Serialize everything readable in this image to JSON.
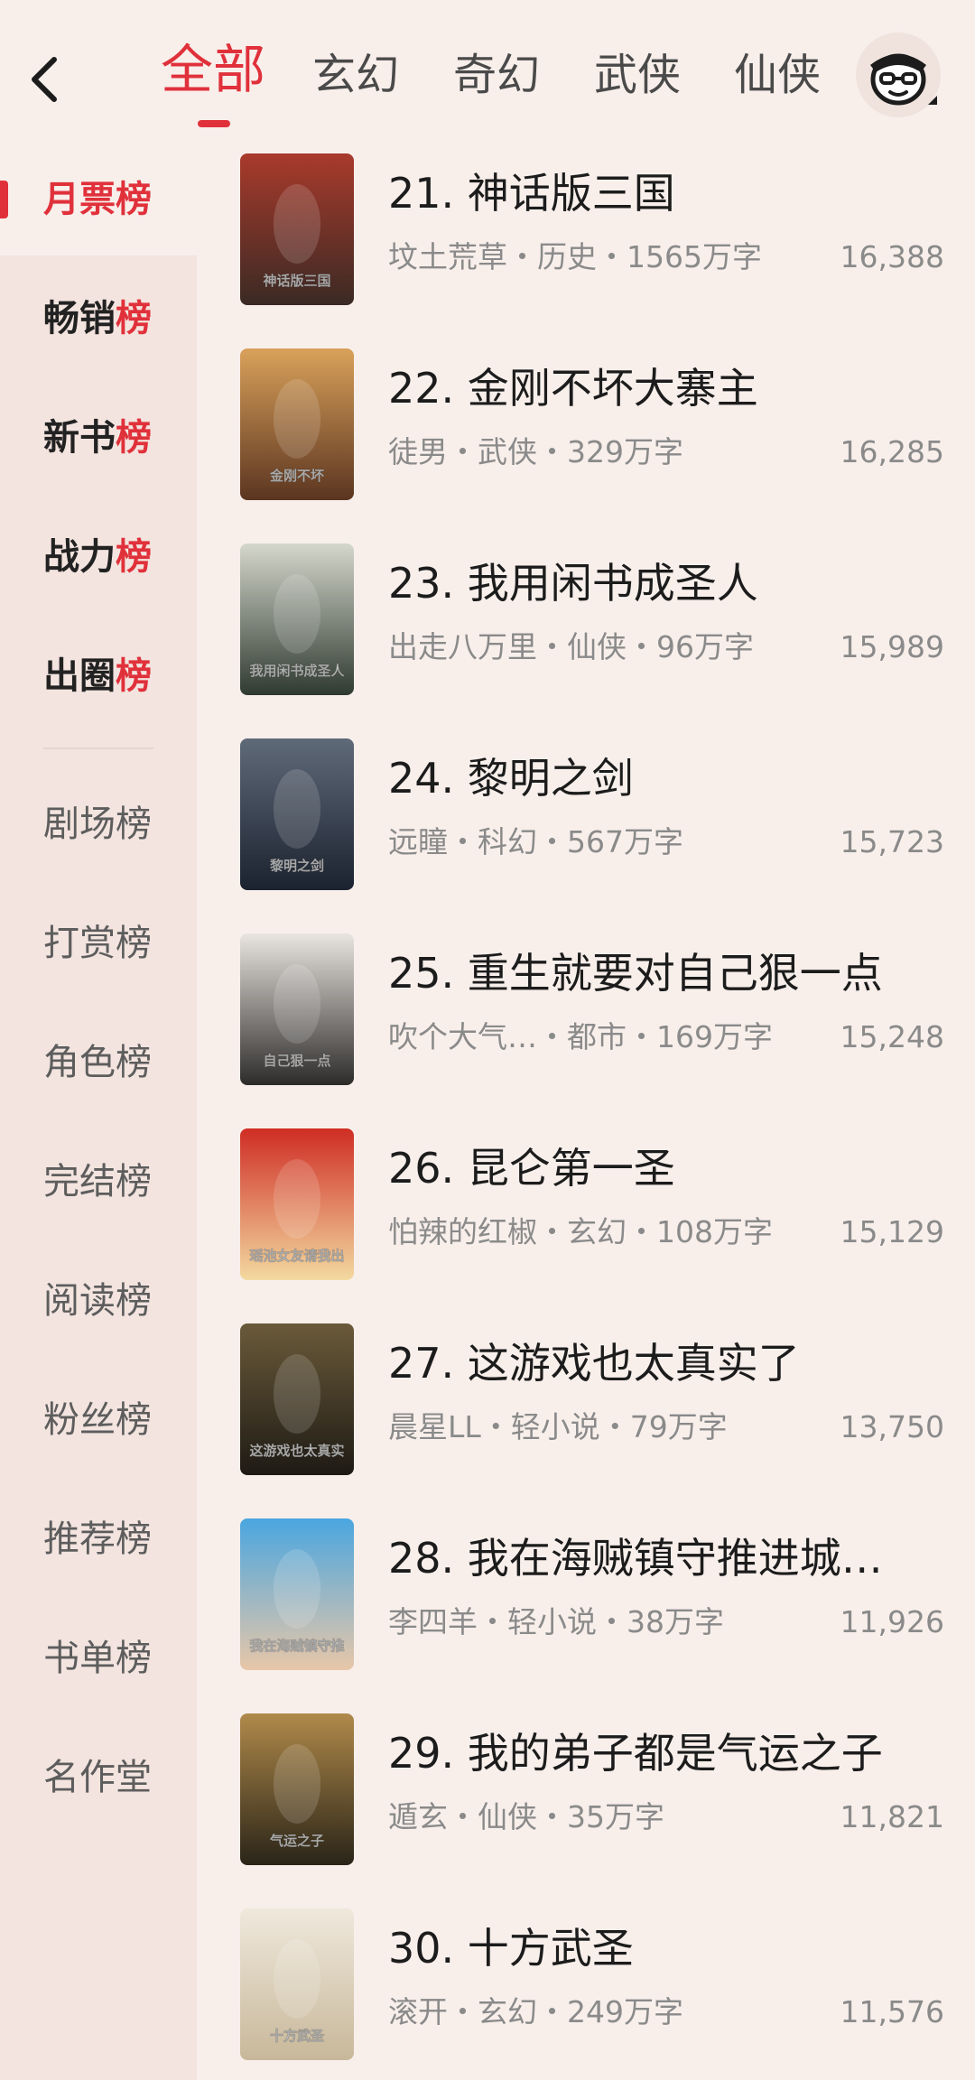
{
  "nav": {
    "tabs": [
      "全部",
      "玄幻",
      "奇幻",
      "武侠",
      "仙侠"
    ],
    "active_tab": "全部"
  },
  "sidebar": {
    "ranked": [
      {
        "a": "月票",
        "b": "榜"
      },
      {
        "a": "畅销",
        "b": "榜"
      },
      {
        "a": "新书",
        "b": "榜"
      },
      {
        "a": "战力",
        "b": "榜"
      },
      {
        "a": "出圈",
        "b": "榜"
      }
    ],
    "plain": [
      "剧场榜",
      "打赏榜",
      "角色榜",
      "完结榜",
      "阅读榜",
      "粉丝榜",
      "推荐榜",
      "书单榜",
      "名作堂"
    ]
  },
  "books": [
    {
      "title": "21. 神话版三国",
      "meta": "坟土荒草・历史・1565万字",
      "score": "16,388",
      "cover_colors": [
        "#a93a2c",
        "#3a2a24"
      ],
      "cover_text": "神话版三国"
    },
    {
      "title": "22. 金刚不坏大寨主",
      "meta": "徒男・武侠・329万字",
      "score": "16,285",
      "cover_colors": [
        "#d9a15a",
        "#5b3520"
      ],
      "cover_text": "金刚不坏"
    },
    {
      "title": "23. 我用闲书成圣人",
      "meta": "出走八万里・仙侠・96万字",
      "score": "15,989",
      "cover_colors": [
        "#d5d7cc",
        "#2f3a30"
      ],
      "cover_text": "我用闲书成圣人"
    },
    {
      "title": "24. 黎明之剑",
      "meta": "远瞳・科幻・567万字",
      "score": "15,723",
      "cover_colors": [
        "#5f6a78",
        "#1b2230"
      ],
      "cover_text": "黎明之剑"
    },
    {
      "title": "25. 重生就要对自己狠一点",
      "meta": "吹个大气…・都市・169万字",
      "score": "15,248",
      "cover_colors": [
        "#e9e5e0",
        "#2d2b2a"
      ],
      "cover_text": "自己狠一点"
    },
    {
      "title": "26. 昆仑第一圣",
      "meta": "怕辣的红椒・玄幻・108万字",
      "score": "15,129",
      "cover_colors": [
        "#cf2d24",
        "#f3d9a0"
      ],
      "cover_text": "瑶池女友请我出山"
    },
    {
      "title": "27. 这游戏也太真实了",
      "meta": "晨星LL・轻小说・79万字",
      "score": "13,750",
      "cover_colors": [
        "#6a5a3a",
        "#1e1a14"
      ],
      "cover_text": "这游戏也太真实了"
    },
    {
      "title": "28. 我在海贼镇守推进城…",
      "meta": "李四羊・轻小说・38万字",
      "score": "11,926",
      "cover_colors": [
        "#4aa6e0",
        "#e8c7a8"
      ],
      "cover_text": "我在海贼镇守推进城一百年"
    },
    {
      "title": "29. 我的弟子都是气运之子",
      "meta": "遁玄・仙侠・35万字",
      "score": "11,821",
      "cover_colors": [
        "#b08a4a",
        "#2a2418"
      ],
      "cover_text": "气运之子"
    },
    {
      "title": "30. 十方武圣",
      "meta": "滚开・玄幻・249万字",
      "score": "11,576",
      "cover_colors": [
        "#efe8dc",
        "#c8b89a"
      ],
      "cover_text": "十方武圣"
    }
  ]
}
